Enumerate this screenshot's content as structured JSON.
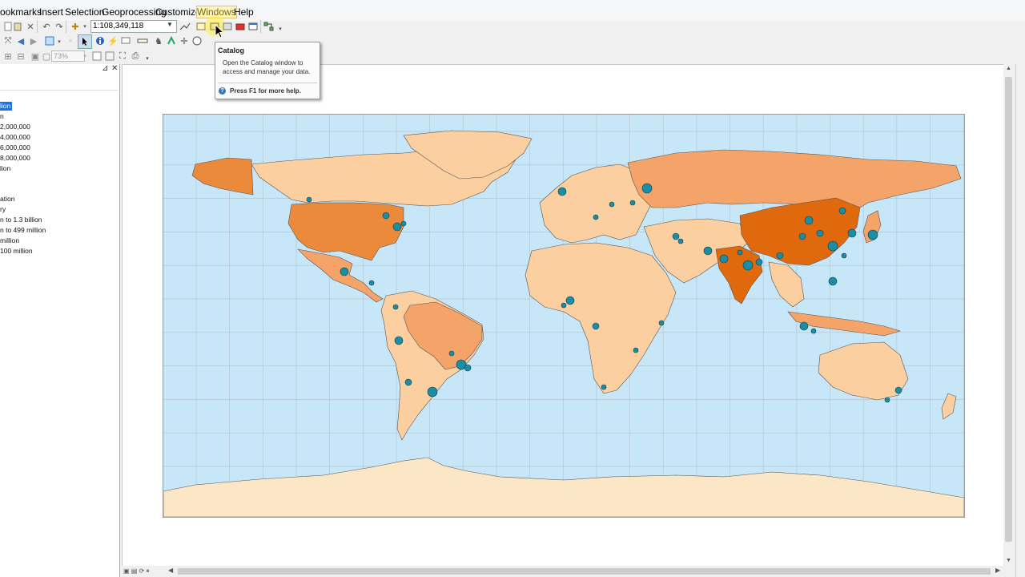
{
  "menubar": {
    "items": [
      "ookmarks",
      "Insert",
      "Selection",
      "Geoprocessing",
      "Customize",
      "Windows",
      "Help"
    ],
    "active": "Windows"
  },
  "toolbar": {
    "scale_value": "1:108,349,118",
    "zoom_value": "73%"
  },
  "tooltip": {
    "title": "Catalog",
    "body": "Open the Catalog window to access and manage your data.",
    "help": "Press F1 for more help."
  },
  "toc": {
    "lines": [
      {
        "text": "lion",
        "selected": true
      },
      {
        "text": "n",
        "selected": false
      },
      {
        "text": " 2,000,000",
        "selected": false
      },
      {
        "text": " 4,000,000",
        "selected": false
      },
      {
        "text": " 6,000,000",
        "selected": false
      },
      {
        "text": " 8,000,000",
        "selected": false
      },
      {
        "text": "lion",
        "selected": false
      },
      {
        "text": "",
        "selected": false
      },
      {
        "text": "",
        "selected": false
      },
      {
        "text": "ation",
        "selected": false
      },
      {
        "text": "ry",
        "selected": false
      },
      {
        "text": "n to 1.3 billion",
        "selected": false
      },
      {
        "text": "n to 499 million",
        "selected": false
      },
      {
        "text": " million",
        "selected": false
      },
      {
        "text": "100 million",
        "selected": false
      }
    ]
  },
  "colors": {
    "ocean": "#c7e7f8",
    "antarctica": "#fbe6c6",
    "country_light": "#fbcfa0",
    "country_mid": "#f4a468",
    "country_dark": "#ec8a3c",
    "country_darkest": "#e0690e",
    "city_dot": "#1b8ea6"
  }
}
